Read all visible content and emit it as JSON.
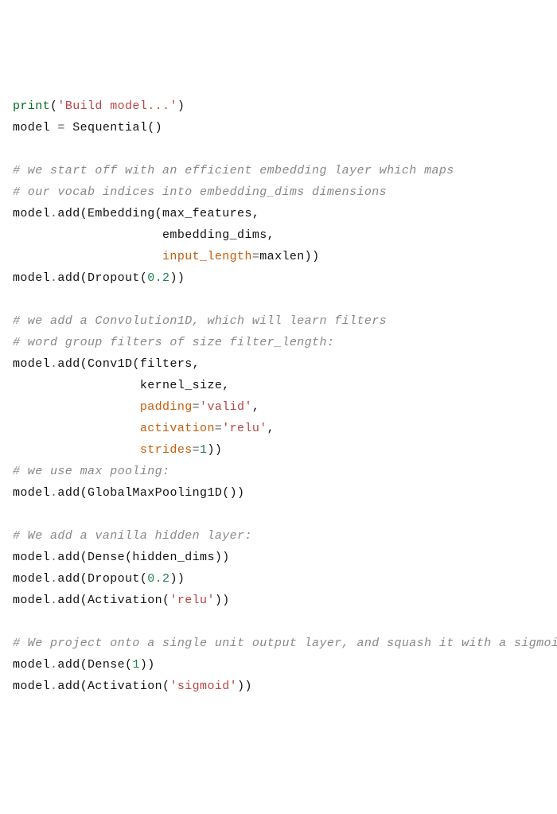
{
  "code": {
    "l1_print": "print",
    "l1_arg": "'Build model...'",
    "l2_model": "model ",
    "l2_eq": "= ",
    "l2_seq": "Sequential()",
    "l4": "# we start off with an efficient embedding layer which maps",
    "l5": "# our vocab indices into embedding_dims dimensions",
    "l6a": "model",
    "l6b": ".",
    "l6c": "add(Embedding(max_features,",
    "l7": "                    embedding_dims,",
    "l8a": "                    ",
    "l8b": "input_length",
    "l8c": "=",
    "l8d": "maxlen))",
    "l9a": "model",
    "l9b": ".",
    "l9c": "add(Dropout(",
    "l9d": "0.2",
    "l9e": "))",
    "l11": "# we add a Convolution1D, which will learn filters",
    "l12": "# word group filters of size filter_length:",
    "l13a": "model",
    "l13b": ".",
    "l13c": "add(Conv1D(filters,",
    "l14": "                 kernel_size,",
    "l15a": "                 ",
    "l15b": "padding",
    "l15c": "=",
    "l15d": "'valid'",
    "l15e": ",",
    "l16a": "                 ",
    "l16b": "activation",
    "l16c": "=",
    "l16d": "'relu'",
    "l16e": ",",
    "l17a": "                 ",
    "l17b": "strides",
    "l17c": "=",
    "l17d": "1",
    "l17e": "))",
    "l18": "# we use max pooling:",
    "l19a": "model",
    "l19b": ".",
    "l19c": "add(GlobalMaxPooling1D())",
    "l21": "# We add a vanilla hidden layer:",
    "l22a": "model",
    "l22b": ".",
    "l22c": "add(Dense(hidden_dims))",
    "l23a": "model",
    "l23b": ".",
    "l23c": "add(Dropout(",
    "l23d": "0.2",
    "l23e": "))",
    "l24a": "model",
    "l24b": ".",
    "l24c": "add(Activation(",
    "l24d": "'relu'",
    "l24e": "))",
    "l26": "# We project onto a single unit output layer, and squash it with a sigmoid:",
    "l27a": "model",
    "l27b": ".",
    "l27c": "add(Dense(",
    "l27d": "1",
    "l27e": "))",
    "l28a": "model",
    "l28b": ".",
    "l28c": "add(Activation(",
    "l28d": "'sigmoid'",
    "l28e": "))"
  }
}
